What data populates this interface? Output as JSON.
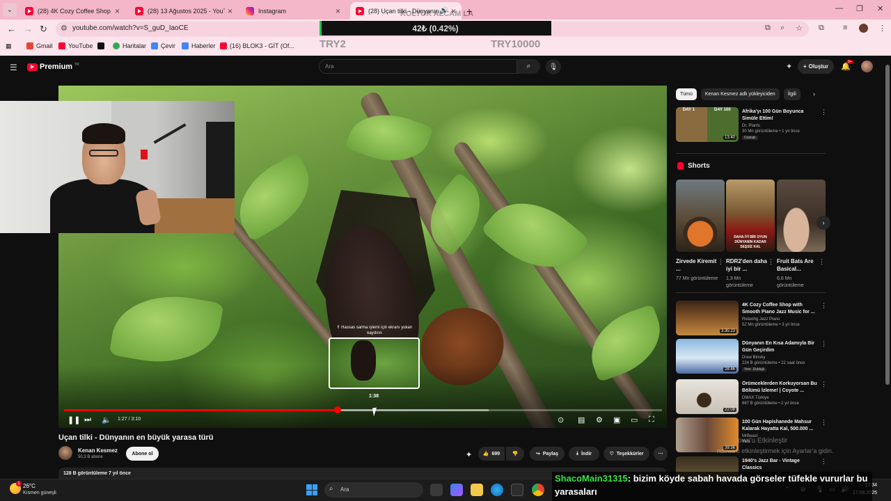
{
  "browser": {
    "tabs": [
      {
        "title": "(28) 4K Cozy Coffee Shop with",
        "active": false
      },
      {
        "title": "(28) 13 Ağustos 2025 - YouTub",
        "active": false
      },
      {
        "title": "Instagram",
        "active": false
      },
      {
        "title": "(28) Uçan tilki - Dünyanın",
        "active": true
      }
    ],
    "url": "youtube.com/watch?v=S_guD_IaoCE",
    "bookmarks": [
      "Gmail",
      "YouTube",
      "Haritalar",
      "Çevir",
      "Haberler",
      "(16) BLOK3 - GİT (Of..."
    ]
  },
  "stream_overlay": {
    "goal_title": "KOLTUK ALCAM LA",
    "goal_amount": "42₺ (0.42%)",
    "goal_start": "TRY2",
    "goal_end": "TRY10000",
    "goal_progress_percent": 0.42
  },
  "yt_header": {
    "logo": "Premium",
    "region": "TR",
    "search_placeholder": "Ara",
    "create_label": "Oluştur",
    "notif_badge": "9+"
  },
  "player": {
    "hover_hint": "⇑ Hassas sarma işlemi için ekranı yukarı kaydırın",
    "hover_time": "1:38",
    "time": "1:27 / 3:10",
    "played_fraction": 0.457,
    "buffered_fraction": 0.71
  },
  "video": {
    "title": "Uçan tilki - Dünyanın en büyük yarasa türü",
    "channel": "Kenan Kesmez",
    "subs": "50,3 B abone",
    "subscribe_label": "Abone ol",
    "likes": "699",
    "share_label": "Paylaş",
    "download_label": "İndir",
    "thanks_label": "Teşekkürler",
    "description_meta": "128 B görüntüleme  7 yıl önce"
  },
  "sidebar": {
    "chips": [
      "Tümü",
      "Kenan Kesmez adlı yükleyiciden",
      "İlgili"
    ],
    "first_rec": {
      "title": "Afrika'yı 100 Gün Boyunca Simüle Ettim!",
      "channel": "Dr. Plants",
      "meta": "30 Mn görüntüleme • 1 yıl önce",
      "duration": "13:40",
      "thumb_labels": [
        "DAY 1",
        "DAY 100"
      ],
      "tag": "Dublajlı"
    },
    "shorts_label": "Shorts",
    "shorts": [
      {
        "title": "Zirvede Kiremit ...",
        "views": "77 Mn görüntüleme"
      },
      {
        "title": "RDR2'den daha iyi bir ...",
        "views": "1,3 Mn görüntüleme",
        "overlay": "DAHA İYİ BİR OYUN DÜNYANIN KADAR SEŞSİZ KAL"
      },
      {
        "title": "Fruit Bats Are Basical...",
        "views": "6,6 Mn görüntüleme"
      }
    ],
    "recs": [
      {
        "title": "4K Cozy Coffee Shop with Smooth Piano Jazz Music for ...",
        "channel": "Relaxing Jazz Piano",
        "meta": "52 Mn görüntüleme • 3 yıl önce",
        "duration": "3:35:23"
      },
      {
        "title": "Dünyanın En Kısa Adamıyla Bir Gün Geçirdim",
        "channel": "Drew Binsky",
        "meta": "224 B görüntüleme • 22 saat önce",
        "duration": "28:46",
        "tags": [
          "Yeni",
          "Dublajlı"
        ]
      },
      {
        "title": "Örümceklerden Korkuyorsan Bu Bölümü İzleme! | Coyote ...",
        "channel": "DMAX Türkiye",
        "meta": "667 B görüntüleme • 2 yıl önce",
        "duration": "22:08"
      },
      {
        "title": "100 Gün Hapishanede Mahsur Kalarak Hayatta Kal, 500.000 ...",
        "channel": "MrBeast",
        "meta": "Yeni",
        "duration": "39:36"
      },
      {
        "title": "1940's Jazz Bar - Vintage Classics",
        "channel": "",
        "meta": "",
        "duration": ""
      }
    ]
  },
  "watermark": {
    "line1": "ows'u Etkinleştir",
    "line2": "ndows'u etkinleştirmek için Ayarlar'a gidin."
  },
  "chat": {
    "user": "ShacoMain31315",
    "message_part1": ": bizim köyde sabah havada görseler tüfekle vururlar bu",
    "message_part2": "yarasaları"
  },
  "taskbar": {
    "temp": "26°C",
    "weather": "Kısmen güneşli",
    "weather_badge": "1",
    "search": "Ara",
    "time": "17:34",
    "date": "17.08.2025"
  },
  "colors": {
    "yt_red": "#ff0000",
    "tabstrip": "#f4b6c9",
    "chat_user": "#38e34a"
  }
}
